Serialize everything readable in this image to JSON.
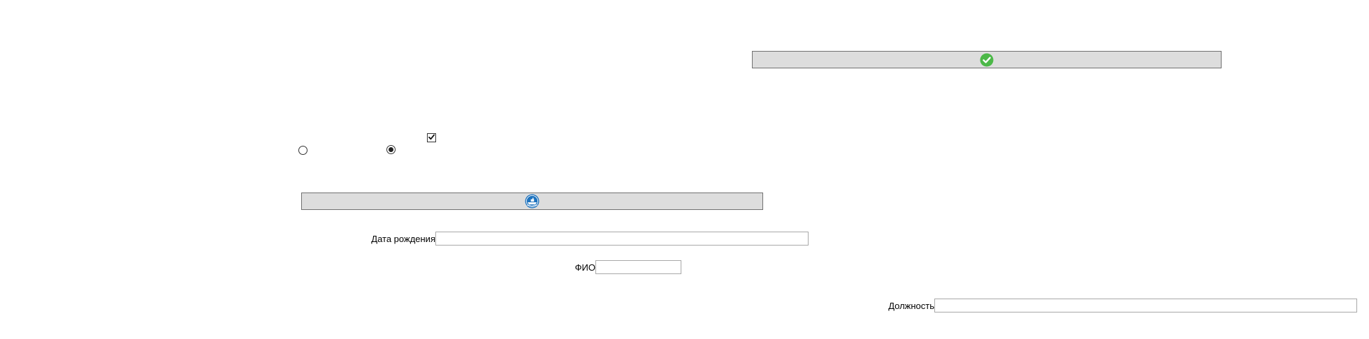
{
  "top_button": {
    "icon": "check-circle-icon",
    "icon_color": "#4cb848"
  },
  "options": {
    "checkbox_checked": true,
    "radio_left_selected": false,
    "radio_right_selected": true
  },
  "middle_button": {
    "icon": "ship-globe-icon",
    "icon_color": "#1e73be"
  },
  "form": {
    "birth_date_label": "Дата рождения",
    "birth_date_value": "",
    "full_name_label": "ФИО",
    "full_name_value": "",
    "position_label": "Должность",
    "position_value": ""
  }
}
